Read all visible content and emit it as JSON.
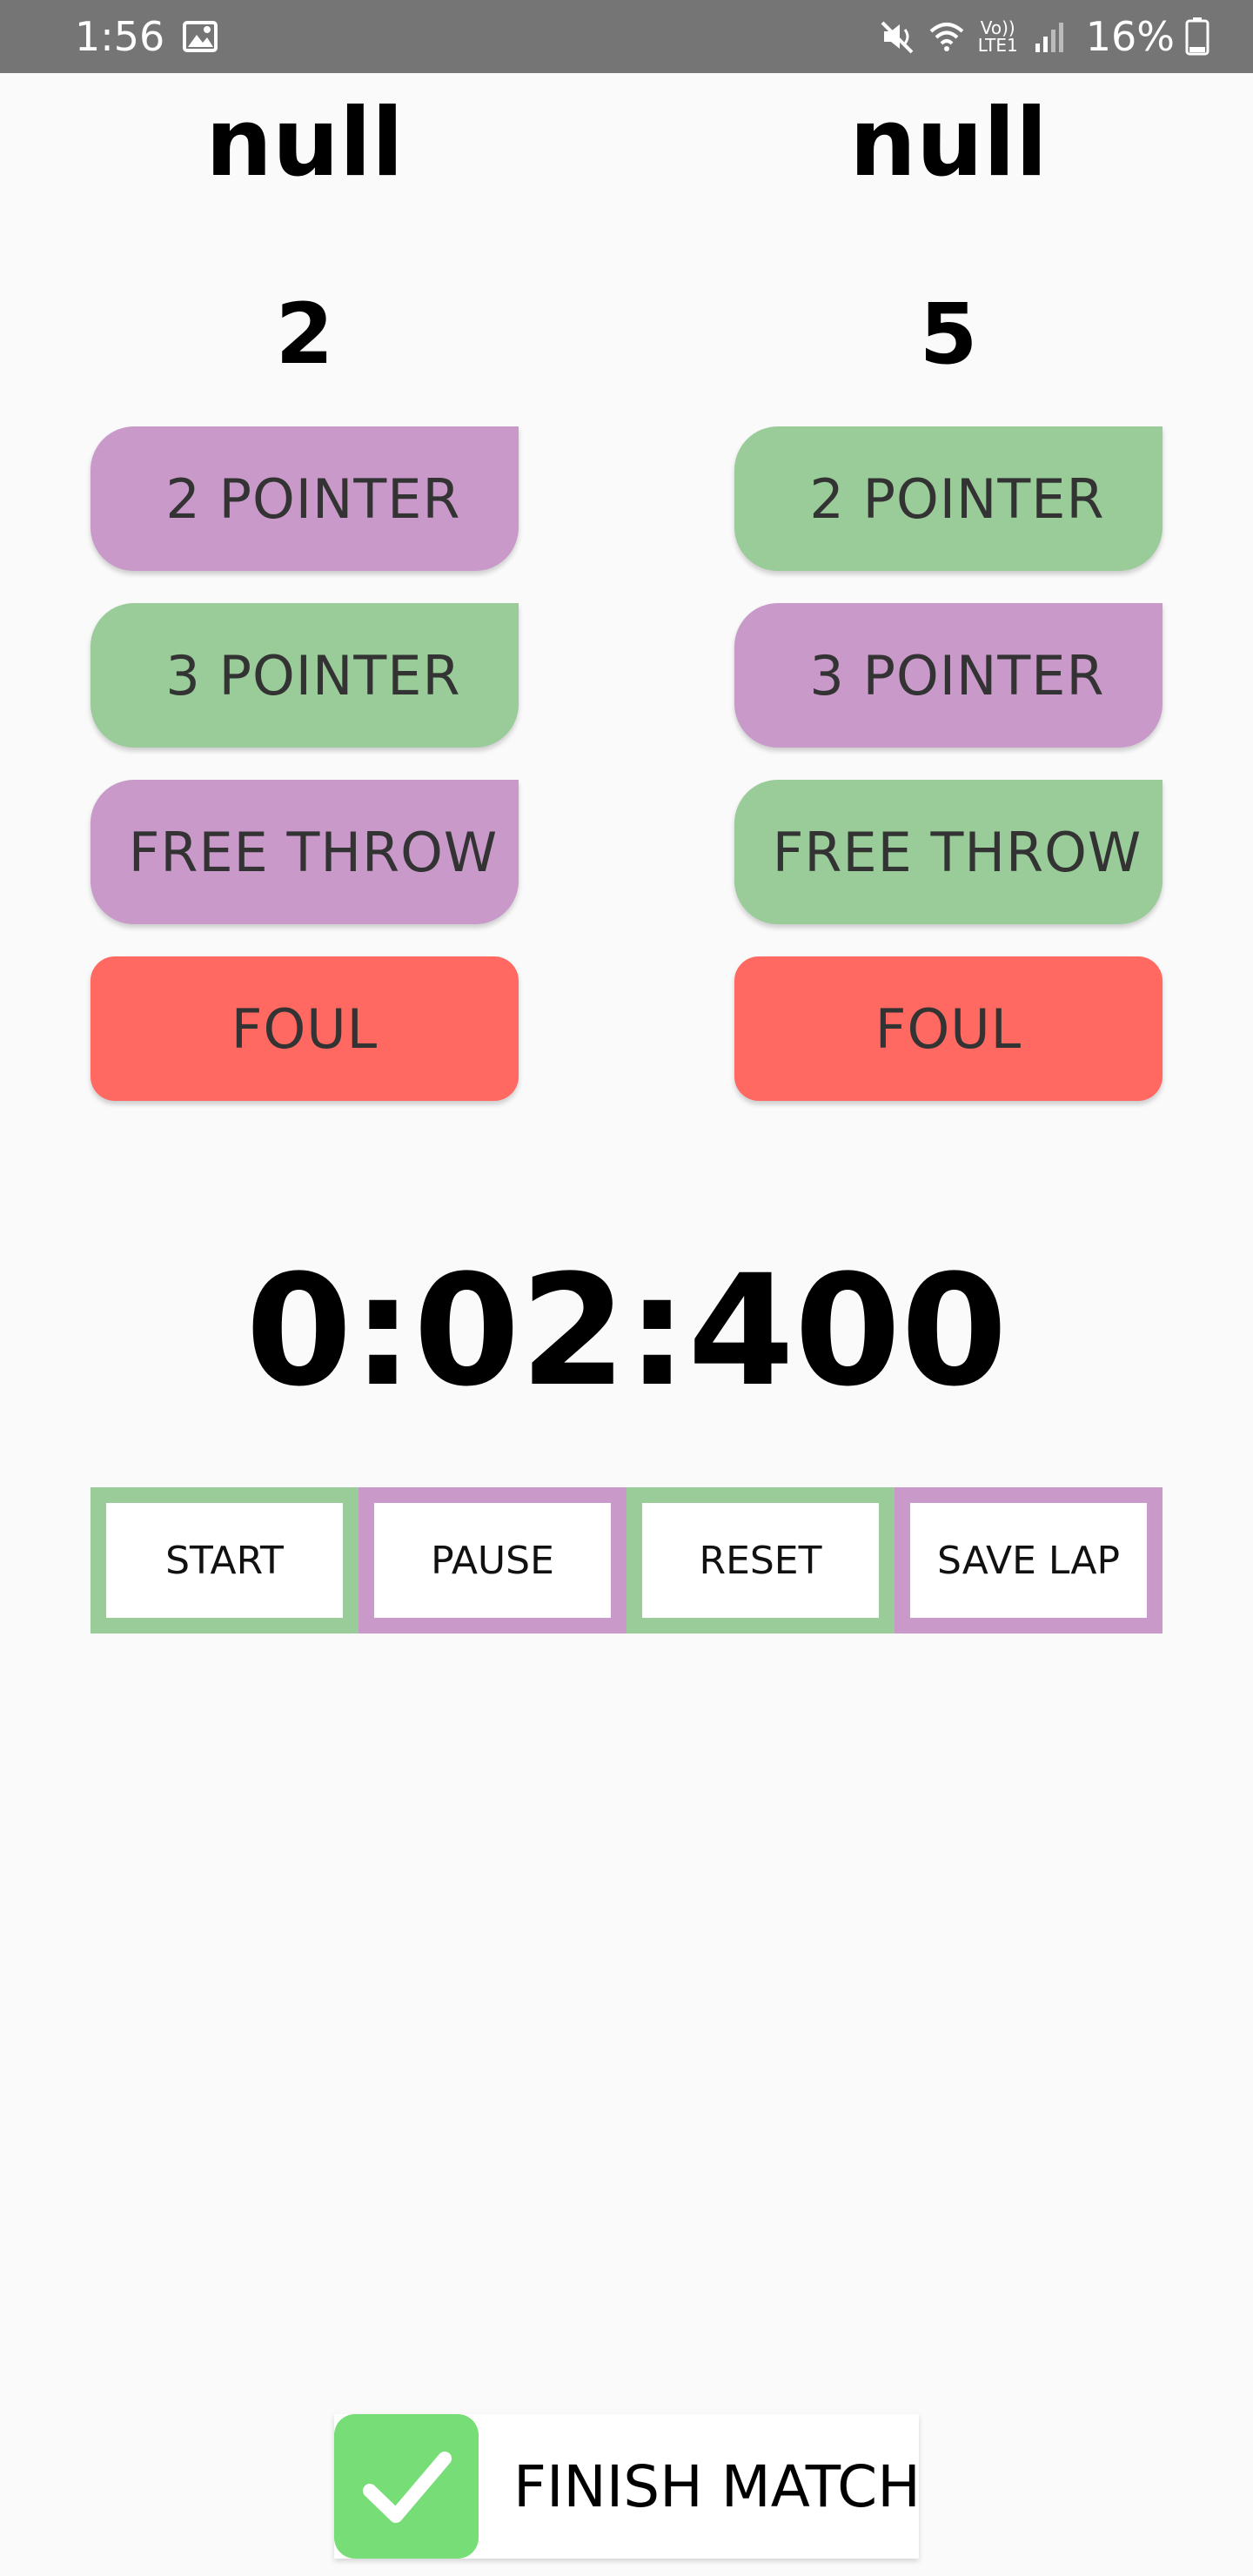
{
  "status_bar": {
    "time": "1:56",
    "battery": "16%",
    "network_label": "Vo)) LTE1",
    "icons": [
      "gallery-icon",
      "mute-icon",
      "wifi-icon",
      "signal-icon",
      "battery-icon"
    ]
  },
  "teams": [
    {
      "name": "null",
      "score": "2",
      "buttons": [
        "2 POINTER",
        "3 POINTER",
        "FREE THROW",
        "FOUL"
      ]
    },
    {
      "name": "null",
      "score": "5",
      "buttons": [
        "2 POINTER",
        "3 POINTER",
        "FREE THROW",
        "FOUL"
      ]
    }
  ],
  "timer": {
    "display": "0:02:400",
    "controls": [
      "START",
      "PAUSE",
      "RESET",
      "SAVE LAP"
    ]
  },
  "finish": {
    "label": "FINISH MATCH",
    "icon": "checkmark-icon"
  },
  "colors": {
    "purple": "#c999c9",
    "green": "#99cc99",
    "red": "#ff6961",
    "finish_green": "#77dd77",
    "status_bar": "#757575"
  }
}
